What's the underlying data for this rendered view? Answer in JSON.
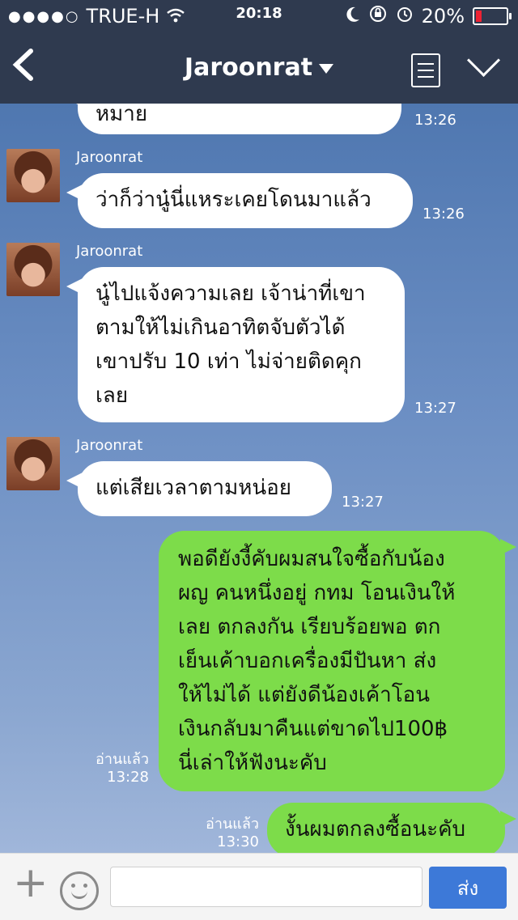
{
  "status_bar": {
    "signal": "●●●●○",
    "carrier": "TRUE-H",
    "time": "20:18",
    "battery": "20%"
  },
  "nav": {
    "title": "Jaroonrat",
    "back_icon": "chevron-left-icon",
    "menu_icon": "notes-icon",
    "collapse_icon": "chevron-down-icon"
  },
  "messages": [
    {
      "sender": "",
      "text": "หมาย",
      "time": "13:26"
    },
    {
      "sender": "Jaroonrat",
      "text": "ว่าก็ว่านู๋นี่แหระเคยโดนมาแล้ว",
      "time": "13:26"
    },
    {
      "sender": "Jaroonrat",
      "lines": [
        "นู๋ไปแจ้งความเลย เจ้าน่าที่เขา",
        "ตามให้ไม่เกินอาทิตจับตัวได้",
        "เขาปรับ 10 เท่า ไม่จ่ายติดคุก",
        "เลย"
      ],
      "time": "13:27"
    },
    {
      "sender": "Jaroonrat",
      "text": "แต่เสียเวลาตามหน่อย",
      "time": "13:27"
    },
    {
      "read": "อ่านแล้ว",
      "lines": [
        "พอดียังงี้คับผมสนใจซื้อกับน้อง",
        "ผญ คนหนึ่งอยู่ กทม โอนเงินให้",
        "เลย ตกลงกัน เรียบร้อยพอ ตก",
        "เย็นเค้าบอกเครื่องมีปันหา ส่ง",
        "ให้ไม่ได้ แต่ยังดีน้องเค้าโอน",
        "เงินกลับมาคืนแต่ขาดไป100฿",
        "นี่เล่าให้ฟังนะคับ"
      ],
      "time": "13:28"
    },
    {
      "read": "อ่านแล้ว",
      "text": "งั้นผมตกลงซื้อนะคับ",
      "time": "13:30"
    }
  ],
  "input": {
    "placeholder": "",
    "send_label": "ส่ง"
  }
}
